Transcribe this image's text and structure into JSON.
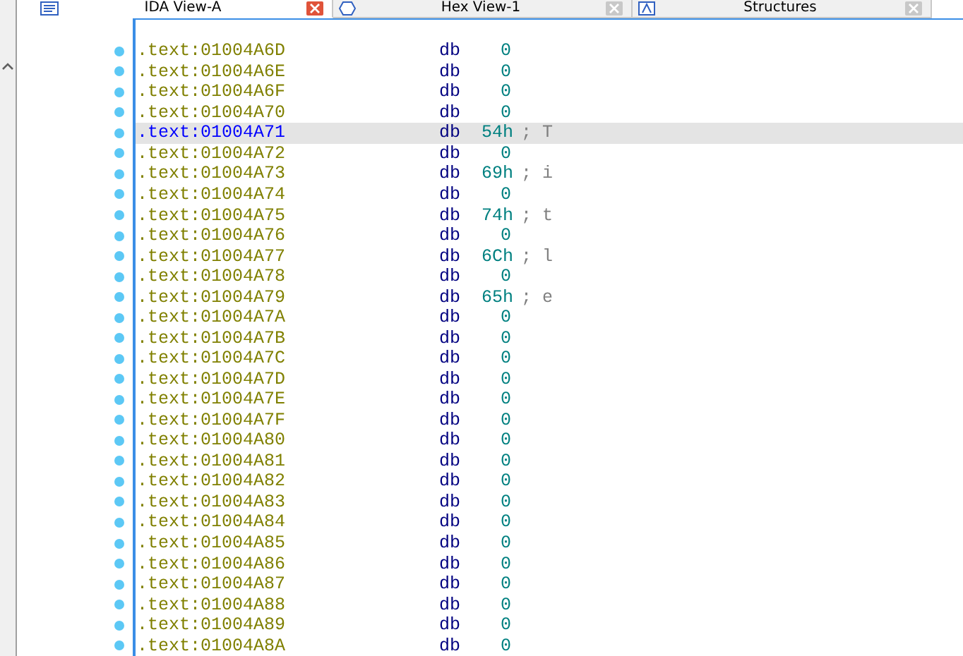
{
  "tabs": [
    {
      "label": "IDA View-A",
      "selected": true,
      "kind": "listing"
    },
    {
      "label": "Hex View-1",
      "selected": false,
      "kind": "hex"
    },
    {
      "label": "Structures",
      "selected": false,
      "kind": "struct"
    }
  ],
  "listing": {
    "rows": [
      {
        "address": ".text:01004A6D",
        "mnemonic": "db",
        "value": "0",
        "selected": false
      },
      {
        "address": ".text:01004A6E",
        "mnemonic": "db",
        "value": "0",
        "selected": false
      },
      {
        "address": ".text:01004A6F",
        "mnemonic": "db",
        "value": "0",
        "selected": false
      },
      {
        "address": ".text:01004A70",
        "mnemonic": "db",
        "value": "0",
        "selected": false
      },
      {
        "address": ".text:01004A71",
        "mnemonic": "db",
        "value": "54h",
        "comment": "; T",
        "selected": true
      },
      {
        "address": ".text:01004A72",
        "mnemonic": "db",
        "value": "0",
        "selected": false
      },
      {
        "address": ".text:01004A73",
        "mnemonic": "db",
        "value": "69h",
        "comment": "; i",
        "selected": false
      },
      {
        "address": ".text:01004A74",
        "mnemonic": "db",
        "value": "0",
        "selected": false
      },
      {
        "address": ".text:01004A75",
        "mnemonic": "db",
        "value": "74h",
        "comment": "; t",
        "selected": false
      },
      {
        "address": ".text:01004A76",
        "mnemonic": "db",
        "value": "0",
        "selected": false
      },
      {
        "address": ".text:01004A77",
        "mnemonic": "db",
        "value": "6Ch",
        "comment": "; l",
        "selected": false
      },
      {
        "address": ".text:01004A78",
        "mnemonic": "db",
        "value": "0",
        "selected": false
      },
      {
        "address": ".text:01004A79",
        "mnemonic": "db",
        "value": "65h",
        "comment": "; e",
        "selected": false
      },
      {
        "address": ".text:01004A7A",
        "mnemonic": "db",
        "value": "0",
        "selected": false
      },
      {
        "address": ".text:01004A7B",
        "mnemonic": "db",
        "value": "0",
        "selected": false
      },
      {
        "address": ".text:01004A7C",
        "mnemonic": "db",
        "value": "0",
        "selected": false
      },
      {
        "address": ".text:01004A7D",
        "mnemonic": "db",
        "value": "0",
        "selected": false
      },
      {
        "address": ".text:01004A7E",
        "mnemonic": "db",
        "value": "0",
        "selected": false
      },
      {
        "address": ".text:01004A7F",
        "mnemonic": "db",
        "value": "0",
        "selected": false
      },
      {
        "address": ".text:01004A80",
        "mnemonic": "db",
        "value": "0",
        "selected": false
      },
      {
        "address": ".text:01004A81",
        "mnemonic": "db",
        "value": "0",
        "selected": false
      },
      {
        "address": ".text:01004A82",
        "mnemonic": "db",
        "value": "0",
        "selected": false
      },
      {
        "address": ".text:01004A83",
        "mnemonic": "db",
        "value": "0",
        "selected": false
      },
      {
        "address": ".text:01004A84",
        "mnemonic": "db",
        "value": "0",
        "selected": false
      },
      {
        "address": ".text:01004A85",
        "mnemonic": "db",
        "value": "0",
        "selected": false
      },
      {
        "address": ".text:01004A86",
        "mnemonic": "db",
        "value": "0",
        "selected": false
      },
      {
        "address": ".text:01004A87",
        "mnemonic": "db",
        "value": "0",
        "selected": false
      },
      {
        "address": ".text:01004A88",
        "mnemonic": "db",
        "value": "0",
        "selected": false
      },
      {
        "address": ".text:01004A89",
        "mnemonic": "db",
        "value": "0",
        "selected": false
      },
      {
        "address": ".text:01004A8A",
        "mnemonic": "db",
        "value": "0",
        "selected": false
      }
    ]
  }
}
